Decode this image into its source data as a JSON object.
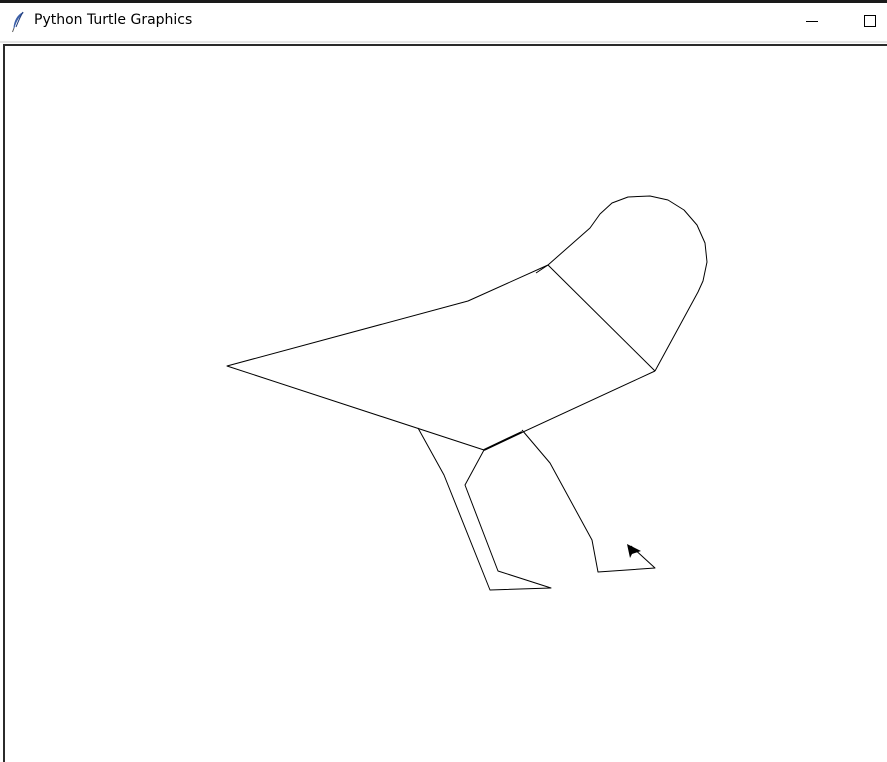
{
  "window": {
    "title": "Python Turtle Graphics",
    "app_icon": "feather-icon",
    "controls": {
      "minimize_icon": "minimize-icon",
      "maximize_icon": "maximize-icon"
    }
  },
  "canvas": {
    "background": "#ffffff",
    "pen_color": "#000000",
    "drawing": "bird line drawing",
    "turtle_cursor_icon": "turtle-arrow-icon"
  }
}
